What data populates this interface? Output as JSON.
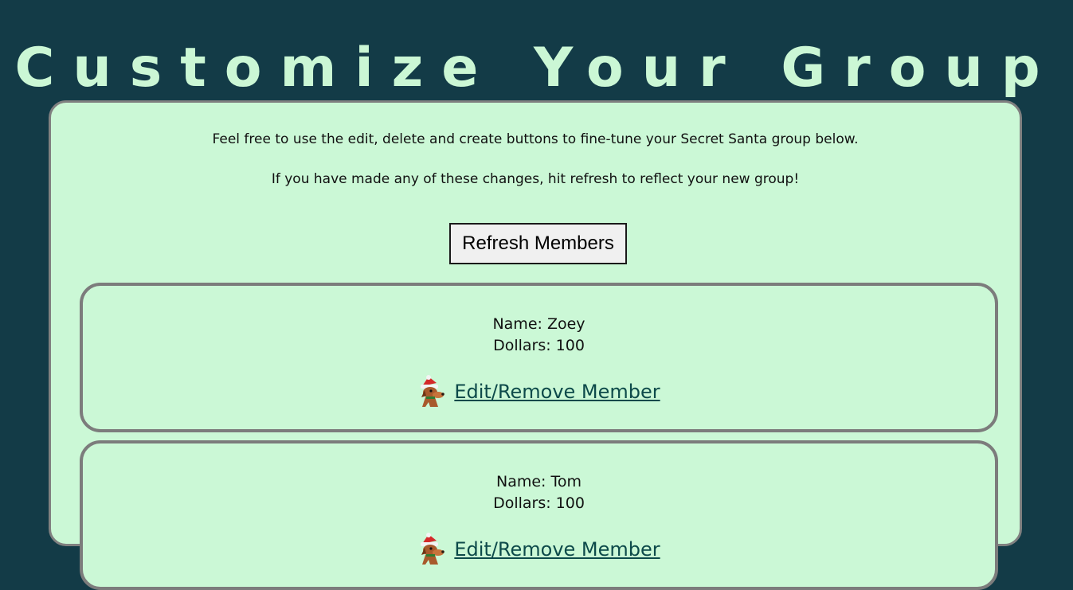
{
  "page": {
    "title": "Customize Your Group",
    "intro_line_1": "Feel free to use the edit, delete and create buttons to fine-tune your Secret Santa group below.",
    "intro_line_2": "If you have made any of these changes, hit refresh to reflect your new group!",
    "refresh_button_label": "Refresh Members"
  },
  "members": [
    {
      "name_text": "Name: Zoey",
      "dollars_text": "Dollars: 100",
      "edit_link_label": "Edit/Remove Member",
      "icon": "santa-dog-icon"
    },
    {
      "name_text": "Name: Tom",
      "dollars_text": "Dollars: 100",
      "edit_link_label": "Edit/Remove Member",
      "icon": "santa-dog-icon"
    }
  ],
  "colors": {
    "background": "#133b47",
    "title": "#cbf7d5",
    "panel": "#cbf8d6",
    "border": "#808080",
    "link": "#0d4a4a"
  }
}
